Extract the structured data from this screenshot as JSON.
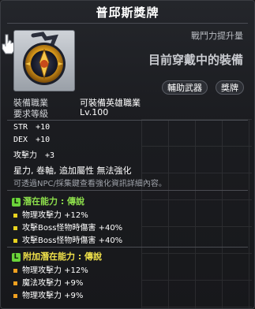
{
  "item": {
    "name": "普邱斯獎牌",
    "power_change_label": "戰鬥力提升量",
    "equipped_label": "目前穿戴中的裝備",
    "tags": [
      "輔助武器",
      "獎牌"
    ]
  },
  "requirements": {
    "job_label": "裝備職業",
    "job_value": "可裝備英雄職業",
    "level_label": "要求等級",
    "level_value": "Lv.100"
  },
  "stats": [
    {
      "name": "STR",
      "value": "+10"
    },
    {
      "name": "DEX",
      "value": "+10"
    },
    {
      "name": "攻擊力",
      "value": "+3"
    }
  ],
  "notes": {
    "enhance": "星力, 卷軸, 追加屬性 無法強化",
    "npc": "可透過NPC/採集鍵查看強化資訊詳細內容。"
  },
  "potential": {
    "badge": "L",
    "label": "潛在能力 : 傳說",
    "lines": [
      "物理攻擊力 +12%",
      "攻擊Boss怪物時傷害 +40%",
      "攻擊Boss怪物時傷害 +40%"
    ]
  },
  "bonus_potential": {
    "badge": "L",
    "label": "附加潛在能力 : 傳說",
    "lines": [
      "物理攻擊力 +12%",
      "魔法攻擊力 +9%",
      "物理攻擊力 +9%"
    ]
  },
  "colors": {
    "legendary_green": "#8ee04c",
    "bonus_yellow": "#f0e14a",
    "bullet_yellow": "#e8d21f",
    "bullet_orange": "#f0a020"
  }
}
